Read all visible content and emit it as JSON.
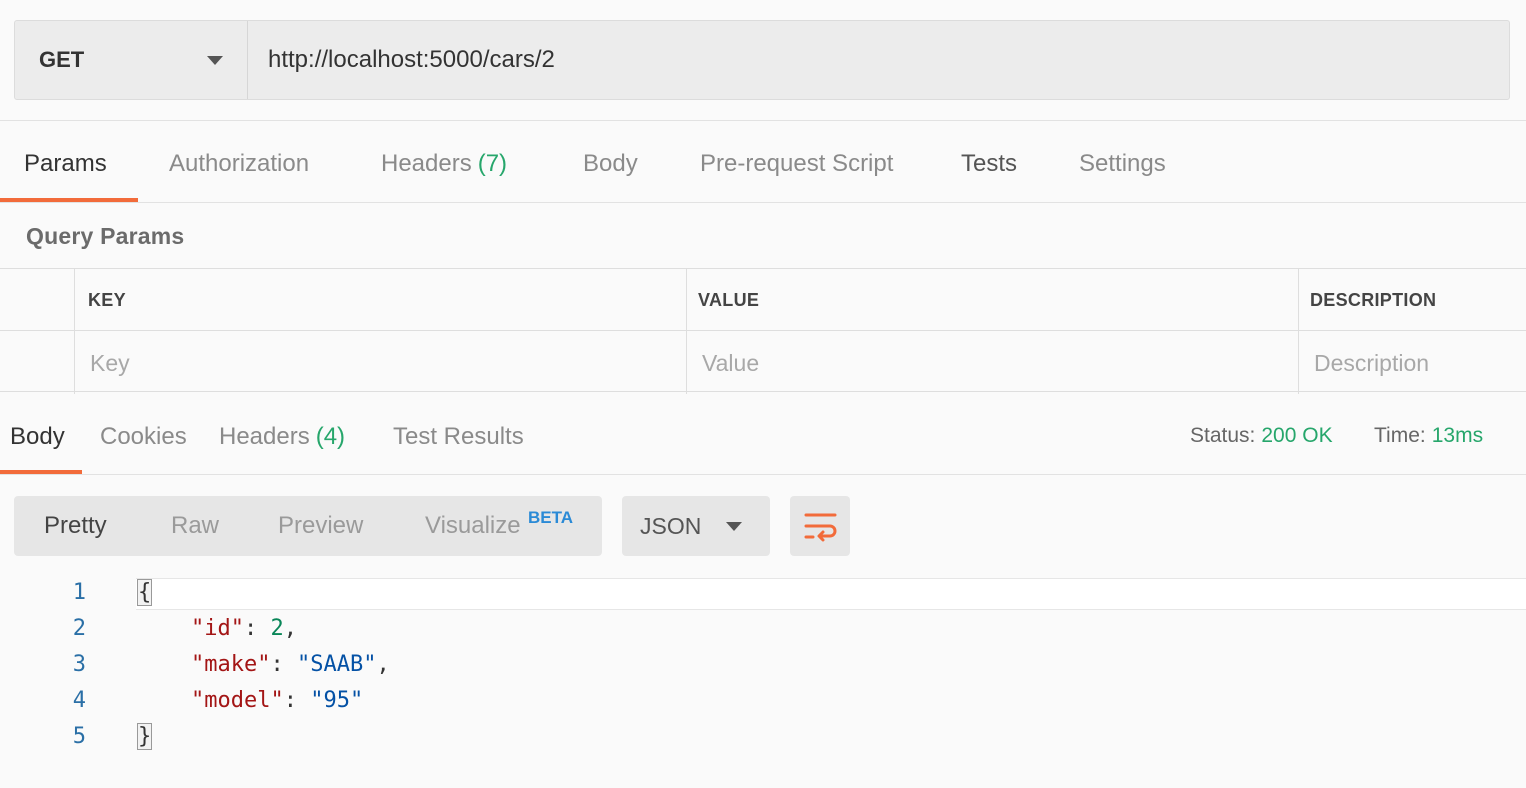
{
  "request": {
    "method": "GET",
    "url": "http://localhost:5000/cars/2"
  },
  "request_tabs": [
    {
      "label": "Params",
      "active": true
    },
    {
      "label": "Authorization"
    },
    {
      "label": "Headers",
      "count": "(7)"
    },
    {
      "label": "Body"
    },
    {
      "label": "Pre-request Script"
    },
    {
      "label": "Tests"
    },
    {
      "label": "Settings"
    }
  ],
  "query_params": {
    "title": "Query Params",
    "columns": [
      "KEY",
      "VALUE",
      "DESCRIPTION"
    ],
    "placeholders": [
      "Key",
      "Value",
      "Description"
    ]
  },
  "response_tabs": [
    {
      "label": "Body",
      "active": true
    },
    {
      "label": "Cookies"
    },
    {
      "label": "Headers",
      "count": "(4)"
    },
    {
      "label": "Test Results"
    }
  ],
  "status": {
    "status_label": "Status:",
    "status_value": "200 OK",
    "time_label": "Time:",
    "time_value": "13ms"
  },
  "view_modes": [
    "Pretty",
    "Raw",
    "Preview",
    "Visualize"
  ],
  "beta_badge": "BETA",
  "format": "JSON",
  "wrap_icon": "wrap-lines-icon",
  "code": {
    "line_numbers": [
      "1",
      "2",
      "3",
      "4",
      "5"
    ],
    "open_brace": "{",
    "close_brace": "}",
    "keys": [
      "\"id\"",
      "\"make\"",
      "\"model\""
    ],
    "values": [
      "2",
      "\"SAAB\"",
      "\"95\""
    ]
  },
  "colors": {
    "accent": "#f26b3a",
    "success": "#26a66b",
    "beta": "#2a8ad6"
  }
}
